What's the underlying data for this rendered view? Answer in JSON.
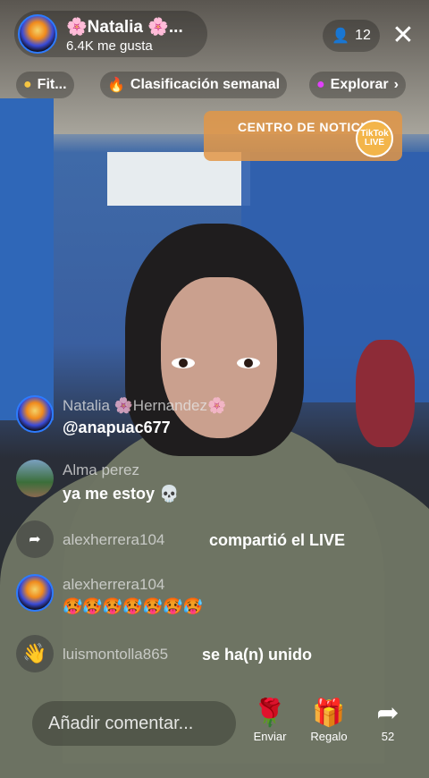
{
  "host": {
    "name": "🌸Natalia 🌸...",
    "likes": "6.4K me gusta"
  },
  "viewers": {
    "count": "12"
  },
  "chips": [
    {
      "label": "Fit..."
    },
    {
      "label": "Clasificación semanal"
    },
    {
      "label": "Explorar"
    }
  ],
  "news": {
    "title": "CENTRO DE NOTICIAS",
    "badge": "TikTok LIVE"
  },
  "chat": [
    {
      "name": "Natalia 🌸Hernandez🌸",
      "message": "@anapuac677"
    },
    {
      "name": "Alma perez",
      "message": "ya me estoy 💀"
    },
    {
      "name": "alexherrera104",
      "message": "compartió el LIVE"
    },
    {
      "name": "alexherrera104",
      "message": "🥵🥵🥵🥵🥵🥵🥵"
    },
    {
      "name": "luismontolla865",
      "message": "se ha(n) unido"
    }
  ],
  "comment": {
    "placeholder": "Añadir comentar..."
  },
  "actions": {
    "send": "Enviar",
    "gift": "Regalo",
    "share_count": "52"
  },
  "colors": {
    "news_bg": "#e2964a",
    "avatar_ring": "#2d7bff"
  }
}
